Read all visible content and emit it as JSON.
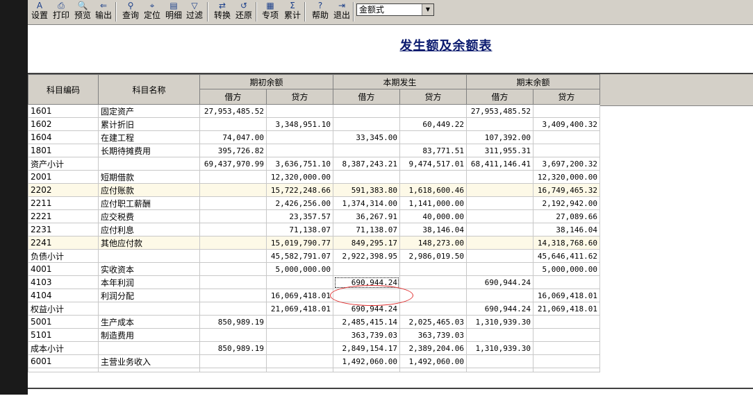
{
  "toolbar": {
    "buttons": [
      {
        "label": "设置",
        "icon": "A"
      },
      {
        "label": "打印",
        "icon": "⎙"
      },
      {
        "label": "预览",
        "icon": "🔍"
      },
      {
        "label": "输出",
        "icon": "⇐"
      },
      {
        "label": "查询",
        "icon": "⚲"
      },
      {
        "label": "定位",
        "icon": "⌖"
      },
      {
        "label": "明细",
        "icon": "▤"
      },
      {
        "label": "过滤",
        "icon": "▽"
      },
      {
        "label": "转换",
        "icon": "⇄"
      },
      {
        "label": "还原",
        "icon": "↺"
      },
      {
        "label": "专项",
        "icon": "▦"
      },
      {
        "label": "累计",
        "icon": "Σ"
      },
      {
        "label": "帮助",
        "icon": "?"
      },
      {
        "label": "退出",
        "icon": "⇥"
      }
    ],
    "format_select": "金额式"
  },
  "report": {
    "title": "发生额及余额表",
    "headers": {
      "code": "科目编码",
      "name": "科目名称",
      "opening": "期初余额",
      "current": "本期发生",
      "closing": "期末余额",
      "debit": "借方",
      "credit": "贷方"
    },
    "rows": [
      {
        "code": "1601",
        "name": "固定资产",
        "od": "27,953,485.52",
        "oc": "",
        "cd": "",
        "cc": "",
        "ed": "27,953,485.52",
        "ec": "",
        "hl": false
      },
      {
        "code": "1602",
        "name": "累计折旧",
        "od": "",
        "oc": "3,348,951.10",
        "cd": "",
        "cc": "60,449.22",
        "ed": "",
        "ec": "3,409,400.32",
        "hl": false
      },
      {
        "code": "1604",
        "name": "在建工程",
        "od": "74,047.00",
        "oc": "",
        "cd": "33,345.00",
        "cc": "",
        "ed": "107,392.00",
        "ec": "",
        "hl": false
      },
      {
        "code": "1801",
        "name": "长期待摊费用",
        "od": "395,726.82",
        "oc": "",
        "cd": "",
        "cc": "83,771.51",
        "ed": "311,955.31",
        "ec": "",
        "hl": false
      },
      {
        "code": "资产小计",
        "name": "",
        "od": "69,437,970.99",
        "oc": "3,636,751.10",
        "cd": "8,387,243.21",
        "cc": "9,474,517.01",
        "ed": "68,411,146.41",
        "ec": "3,697,200.32",
        "hl": false
      },
      {
        "code": "2001",
        "name": "短期借款",
        "od": "",
        "oc": "12,320,000.00",
        "cd": "",
        "cc": "",
        "ed": "",
        "ec": "12,320,000.00",
        "hl": false
      },
      {
        "code": "2202",
        "name": "应付账款",
        "od": "",
        "oc": "15,722,248.66",
        "cd": "591,383.80",
        "cc": "1,618,600.46",
        "ed": "",
        "ec": "16,749,465.32",
        "hl": true
      },
      {
        "code": "2211",
        "name": "应付职工薪酬",
        "od": "",
        "oc": "2,426,256.00",
        "cd": "1,374,314.00",
        "cc": "1,141,000.00",
        "ed": "",
        "ec": "2,192,942.00",
        "hl": false
      },
      {
        "code": "2221",
        "name": "应交税费",
        "od": "",
        "oc": "23,357.57",
        "cd": "36,267.91",
        "cc": "40,000.00",
        "ed": "",
        "ec": "27,089.66",
        "hl": false
      },
      {
        "code": "2231",
        "name": "应付利息",
        "od": "",
        "oc": "71,138.07",
        "cd": "71,138.07",
        "cc": "38,146.04",
        "ed": "",
        "ec": "38,146.04",
        "hl": false
      },
      {
        "code": "2241",
        "name": "其他应付款",
        "od": "",
        "oc": "15,019,790.77",
        "cd": "849,295.17",
        "cc": "148,273.00",
        "ed": "",
        "ec": "14,318,768.60",
        "hl": true
      },
      {
        "code": "负债小计",
        "name": "",
        "od": "",
        "oc": "45,582,791.07",
        "cd": "2,922,398.95",
        "cc": "2,986,019.50",
        "ed": "",
        "ec": "45,646,411.62",
        "hl": false
      },
      {
        "code": "4001",
        "name": "实收资本",
        "od": "",
        "oc": "5,000,000.00",
        "cd": "",
        "cc": "",
        "ed": "",
        "ec": "5,000,000.00",
        "hl": false
      },
      {
        "code": "4103",
        "name": "本年利润",
        "od": "",
        "oc": "",
        "cd": "690,944.24",
        "cc": "",
        "ed": "690,944.24",
        "ec": "",
        "hl": false,
        "sel": true
      },
      {
        "code": "4104",
        "name": "利润分配",
        "od": "",
        "oc": "16,069,418.01",
        "cd": "",
        "cc": "",
        "ed": "",
        "ec": "16,069,418.01",
        "hl": false
      },
      {
        "code": "权益小计",
        "name": "",
        "od": "",
        "oc": "21,069,418.01",
        "cd": "690,944.24",
        "cc": "",
        "ed": "690,944.24",
        "ec": "21,069,418.01",
        "hl": false
      },
      {
        "code": "5001",
        "name": "生产成本",
        "od": "850,989.19",
        "oc": "",
        "cd": "2,485,415.14",
        "cc": "2,025,465.03",
        "ed": "1,310,939.30",
        "ec": "",
        "hl": false
      },
      {
        "code": "5101",
        "name": "制造费用",
        "od": "",
        "oc": "",
        "cd": "363,739.03",
        "cc": "363,739.03",
        "ed": "",
        "ec": "",
        "hl": false
      },
      {
        "code": "成本小计",
        "name": "",
        "od": "850,989.19",
        "oc": "",
        "cd": "2,849,154.17",
        "cc": "2,389,204.06",
        "ed": "1,310,939.30",
        "ec": "",
        "hl": false
      },
      {
        "code": "6001",
        "name": "主营业务收入",
        "od": "",
        "oc": "",
        "cd": "1,492,060.00",
        "cc": "1,492,060.00",
        "ed": "",
        "ec": "",
        "hl": false
      }
    ]
  },
  "colors": {
    "toolbar_bg": "#d4d0c8",
    "title": "#0a1a6e",
    "row_highlight": "#fdf9e7",
    "annotation": "#e03030"
  }
}
